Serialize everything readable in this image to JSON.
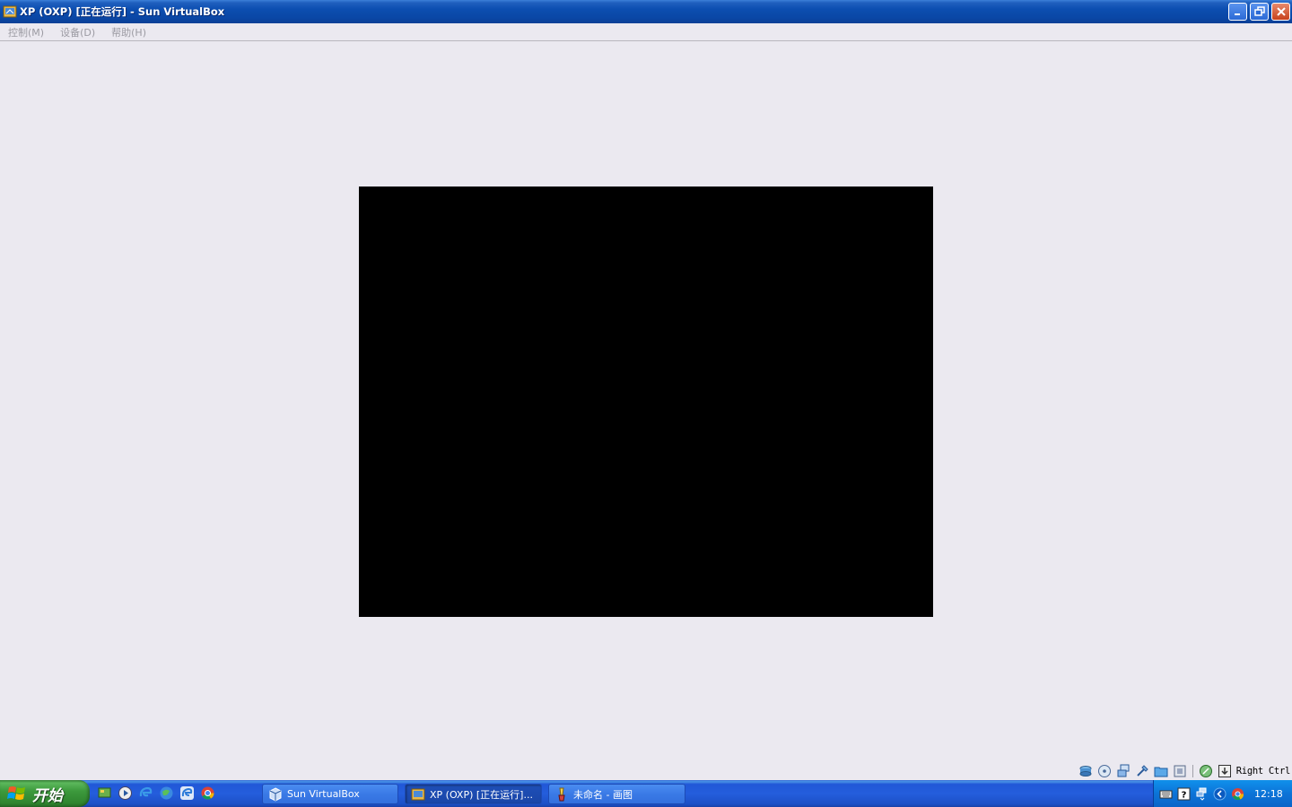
{
  "window": {
    "title": "XP (OXP) [正在运行] - Sun VirtualBox"
  },
  "menubar": {
    "items": [
      {
        "label": "控制(M)"
      },
      {
        "label": "设备(D)"
      },
      {
        "label": "帮助(H)"
      }
    ]
  },
  "statusbar": {
    "icons": [
      "hard-disk-icon",
      "cd-dvd-icon",
      "network-icon",
      "usb-icon",
      "shared-folder-icon",
      "virtualization-icon",
      "mouse-integration-icon",
      "host-key-icon"
    ],
    "host_key": "Right Ctrl"
  },
  "taskbar": {
    "start_label": "开始",
    "quicklaunch": [
      "show-desktop-icon",
      "media-player-icon",
      "ie-icon",
      "browser-icon",
      "ie-alt-icon",
      "chrome-icon"
    ],
    "tasks": [
      {
        "label": "Sun VirtualBox",
        "active": false
      },
      {
        "label": "XP (OXP) [正在运行]...",
        "active": true
      },
      {
        "label": "未命名 - 画图",
        "active": false
      }
    ],
    "clock": "12:18"
  }
}
